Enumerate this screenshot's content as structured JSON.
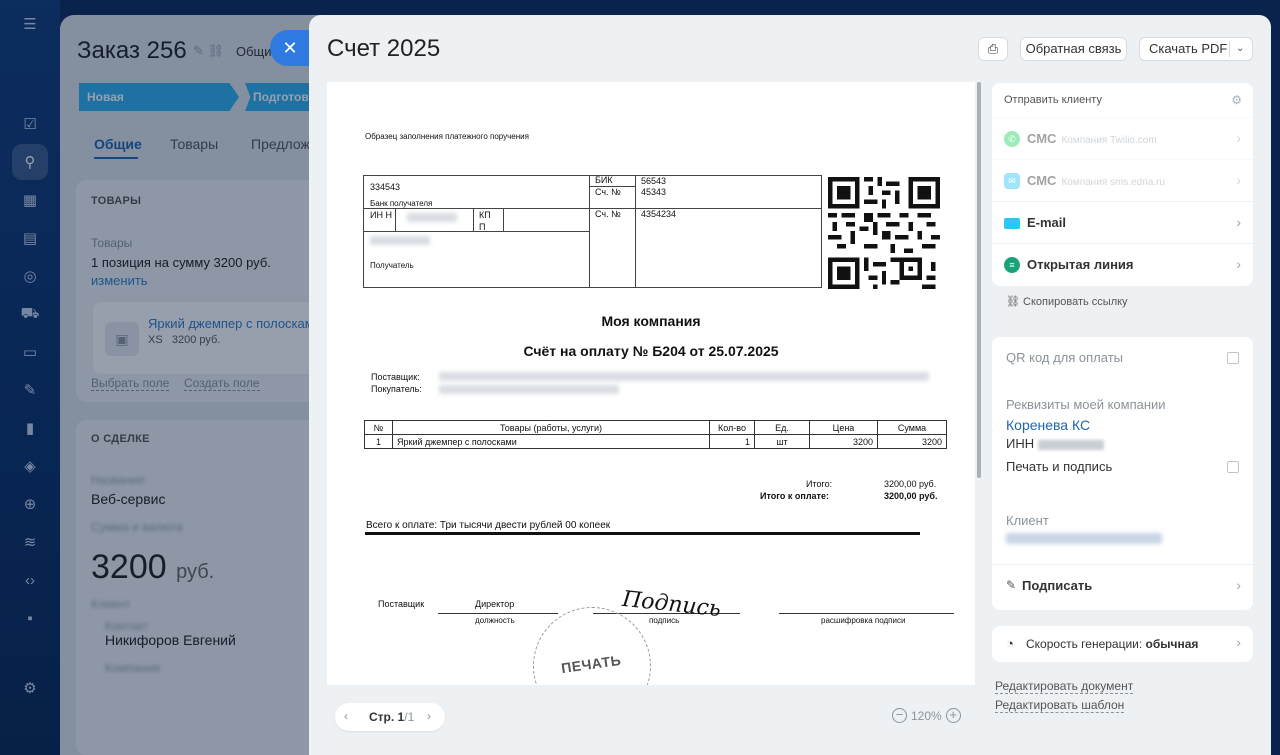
{
  "order": {
    "title": "Заказ 256",
    "general_tab_short": "Общие",
    "stages": [
      "Новая",
      "Подготовка"
    ],
    "tabs": [
      "Общие",
      "Товары",
      "Предлож"
    ],
    "products_header": "ТОВАРЫ",
    "products_label": "Товары",
    "products_summary": "1 позиция на сумму 3200 руб.",
    "change_link": "изменить",
    "product_name": "Яркий джемпер с полосками",
    "product_meta": "XS   3200 руб.",
    "select_field": "Выбрать поле",
    "create_field": "Создать поле",
    "deal_header": "О СДЕЛКЕ",
    "name_label": "Название",
    "name_value": "Веб-сервис",
    "amount_label": "Сумма и валюта",
    "amount_value": "3200",
    "amount_currency": "руб.",
    "client_label": "Клиент",
    "contact_label": "Контакт",
    "contact_value": "Никифоров Евгений",
    "company_label": "Компания"
  },
  "panel": {
    "title": "Счет 2025",
    "feedback": "Обратная связь",
    "download_pdf": "Скачать PDF"
  },
  "document": {
    "sample_caption": "Образец заполнения платежного поручения",
    "bik_label": "БИК",
    "bik_value": "56543",
    "acct_label": "Сч. №",
    "acct_value1": "45343",
    "acct_value2": "4354234",
    "bank_code": "334543",
    "bank_label": "Банк получателя",
    "inn_label": "ИН Н",
    "kpp_label": "КП П",
    "recipient_label": "Получатель",
    "company": "Моя компания",
    "invoice_title": "Счёт на оплату № Б204 от 25.07.2025",
    "supplier_label": "Поставщик:",
    "buyer_label": "Покупатель:",
    "table_headers": [
      "№",
      "Товары (работы, услуги)",
      "Кол-во",
      "Ед.",
      "Цена",
      "Сумма"
    ],
    "table_rows": [
      [
        "1",
        "Яркий джемпер с полосками",
        "1",
        "шт",
        "3200",
        "3200"
      ]
    ],
    "total_label": "Итого:",
    "total_value": "3200,00 руб.",
    "total_to_pay_label": "Итого к оплате:",
    "total_to_pay_value": "3200,00 руб.",
    "in_words": "Всего к оплате: Три тысячи двести рублей 00 копеек",
    "supplier_sign": "Поставщик",
    "director": "Директор",
    "position": "должность",
    "signature_caption": "подпись",
    "signature_text": "Подпись",
    "transcript": "расшифровка подписи",
    "stamp": "ПЕЧАТЬ"
  },
  "pager": {
    "prefix": "Стр. ",
    "current": "1",
    "total": "/1",
    "zoom": "120%"
  },
  "sidebar": {
    "send_header": "Отправить клиенту",
    "sms1": "СМС",
    "sms1_sub": "Компания Twilio.com",
    "sms2": "СМС",
    "sms2_sub": "Компания sms.edna.ru",
    "email": "E-mail",
    "open_line": "Открытая линия",
    "copy_link": "Скопировать ссылку",
    "qr_label": "QR код для оплаты",
    "requisites_label": "Реквизиты моей компании",
    "my_company": "Коренева КС",
    "inn_label": "ИНН",
    "stamp_sign": "Печать и подпись",
    "client_label": "Клиент",
    "sign": "Подписать",
    "speed_label": "Скорость генерации:",
    "speed_value": "обычная",
    "edit_document": "Редактировать документ",
    "edit_template": "Редактировать шаблон"
  },
  "colors": {
    "accent": "#2f7ae0",
    "stage": "#2fb0f0",
    "whatsapp": "#25d366",
    "email": "#2fc6f6",
    "open_line": "#1aa37a"
  }
}
